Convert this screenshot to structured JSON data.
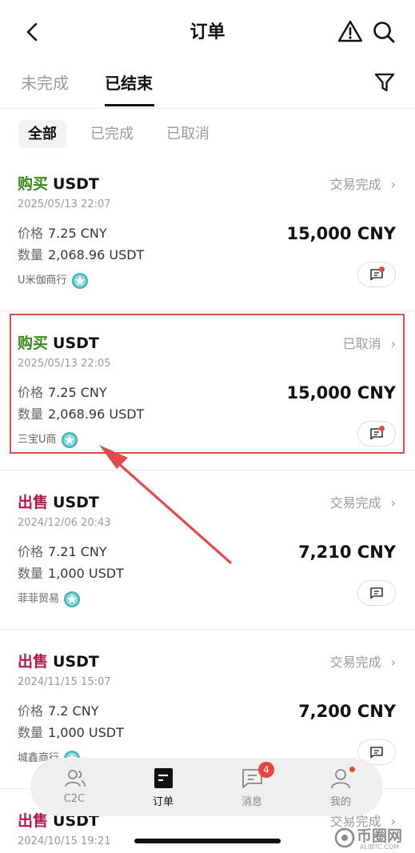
{
  "header": {
    "title": "订单"
  },
  "tabs": [
    {
      "label": "未完成"
    },
    {
      "label": "已结束"
    }
  ],
  "filters": [
    {
      "label": "全部"
    },
    {
      "label": "已完成"
    },
    {
      "label": "已取消"
    }
  ],
  "orders": [
    {
      "action": "购买",
      "coin": "USDT",
      "status": "交易完成",
      "time": "2025/05/13 22:07",
      "price_label": "价格",
      "price": "7.25 CNY",
      "qty_label": "数量",
      "qty": "2,068.96 USDT",
      "total": "15,000 CNY",
      "merchant": "U米伽商行",
      "unread": true
    },
    {
      "action": "购买",
      "coin": "USDT",
      "status": "已取消",
      "time": "2025/05/13 22:05",
      "price_label": "价格",
      "price": "7.25 CNY",
      "qty_label": "数量",
      "qty": "2,068.96 USDT",
      "total": "15,000 CNY",
      "merchant": "三宝U商",
      "unread": true
    },
    {
      "action": "出售",
      "coin": "USDT",
      "status": "交易完成",
      "time": "2024/12/06 20:43",
      "price_label": "价格",
      "price": "7.21 CNY",
      "qty_label": "数量",
      "qty": "1,000 USDT",
      "total": "7,210 CNY",
      "merchant": "菲菲贸易",
      "unread": false
    },
    {
      "action": "出售",
      "coin": "USDT",
      "status": "交易完成",
      "time": "2024/11/15 15:07",
      "price_label": "价格",
      "price": "7.2 CNY",
      "qty_label": "数量",
      "qty": "1,000 USDT",
      "total": "7,200 CNY",
      "merchant": "城鑫商行",
      "unread": false
    },
    {
      "action": "出售",
      "coin": "USDT",
      "status": "交易完成",
      "time": "2024/10/15 19:21"
    }
  ],
  "nav": {
    "items": [
      {
        "label": "C2C"
      },
      {
        "label": "订单"
      },
      {
        "label": "消息"
      },
      {
        "label": "我的"
      }
    ],
    "message_badge": "4"
  },
  "watermark": {
    "name": "币圈网",
    "domain": "ALIBTC.COM"
  },
  "colors": {
    "buy": "#3a8a1e",
    "sell": "#b3174c",
    "highlight": "#e34a4a",
    "badge": "#e4463f"
  },
  "icons": {
    "back": "chevron-left-icon",
    "warning": "warning-triangle-icon",
    "search": "search-icon",
    "filter": "filter-funnel-icon",
    "chat": "chat-icon",
    "verified": "verified-star-icon"
  }
}
